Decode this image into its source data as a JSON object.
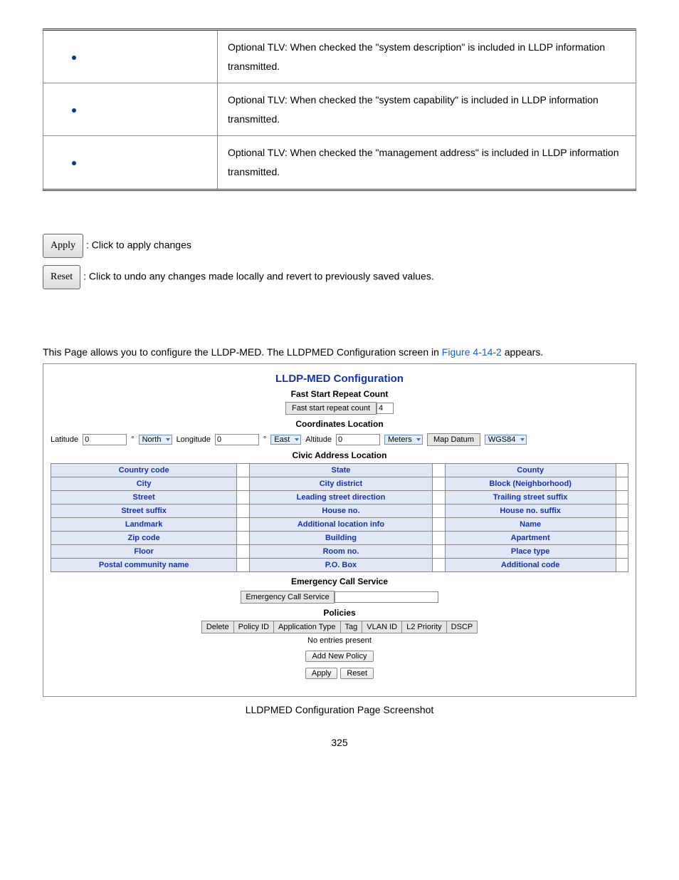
{
  "tlv_rows": [
    "Optional TLV: When checked the \"system description\" is included in LLDP information transmitted.",
    "Optional TLV: When checked the \"system capability\" is included in LLDP information transmitted.",
    "Optional TLV: When checked the \"management address\" is included in LLDP information transmitted."
  ],
  "apply": {
    "button": "Apply",
    "desc": ": Click to apply changes"
  },
  "reset": {
    "button": "Reset",
    "desc": ": Click to undo any changes made locally and revert to previously saved values."
  },
  "intro": {
    "text": "This Page allows you to configure the LLDP-MED. The LLDPMED Configuration screen in ",
    "figref": "Figure 4-14-2",
    "tail": " appears."
  },
  "shot": {
    "title": "LLDP-MED Configuration",
    "fast_sub": "Fast Start Repeat Count",
    "fast_label": "Fast start repeat count",
    "fast_value": "4",
    "coord_sub": "Coordinates Location",
    "coord": {
      "lat_label": "Latitude",
      "lat_val": "0",
      "lat_dir": "North",
      "lon_label": "Longitude",
      "lon_val": "0",
      "lon_dir": "East",
      "alt_label": "Altitude",
      "alt_val": "0",
      "alt_unit": "Meters",
      "md_label": "Map Datum",
      "md_val": "WGS84"
    },
    "civic_sub": "Civic Address Location",
    "civic_rows": [
      [
        "Country code",
        "State",
        "County"
      ],
      [
        "City",
        "City district",
        "Block (Neighborhood)"
      ],
      [
        "Street",
        "Leading street direction",
        "Trailing street suffix"
      ],
      [
        "Street suffix",
        "House no.",
        "House no. suffix"
      ],
      [
        "Landmark",
        "Additional location info",
        "Name"
      ],
      [
        "Zip code",
        "Building",
        "Apartment"
      ],
      [
        "Floor",
        "Room no.",
        "Place type"
      ],
      [
        "Postal community name",
        "P.O. Box",
        "Additional code"
      ]
    ],
    "ecs_sub": "Emergency Call Service",
    "ecs_label": "Emergency Call Service",
    "pol_sub": "Policies",
    "pol_headers": [
      "Delete",
      "Policy ID",
      "Application Type",
      "Tag",
      "VLAN ID",
      "L2 Priority",
      "DSCP"
    ],
    "pol_empty": "No entries present",
    "btn_add": "Add New Policy",
    "btn_apply": "Apply",
    "btn_reset": "Reset"
  },
  "caption": "LLDPMED Configuration Page Screenshot",
  "page_num": "325"
}
